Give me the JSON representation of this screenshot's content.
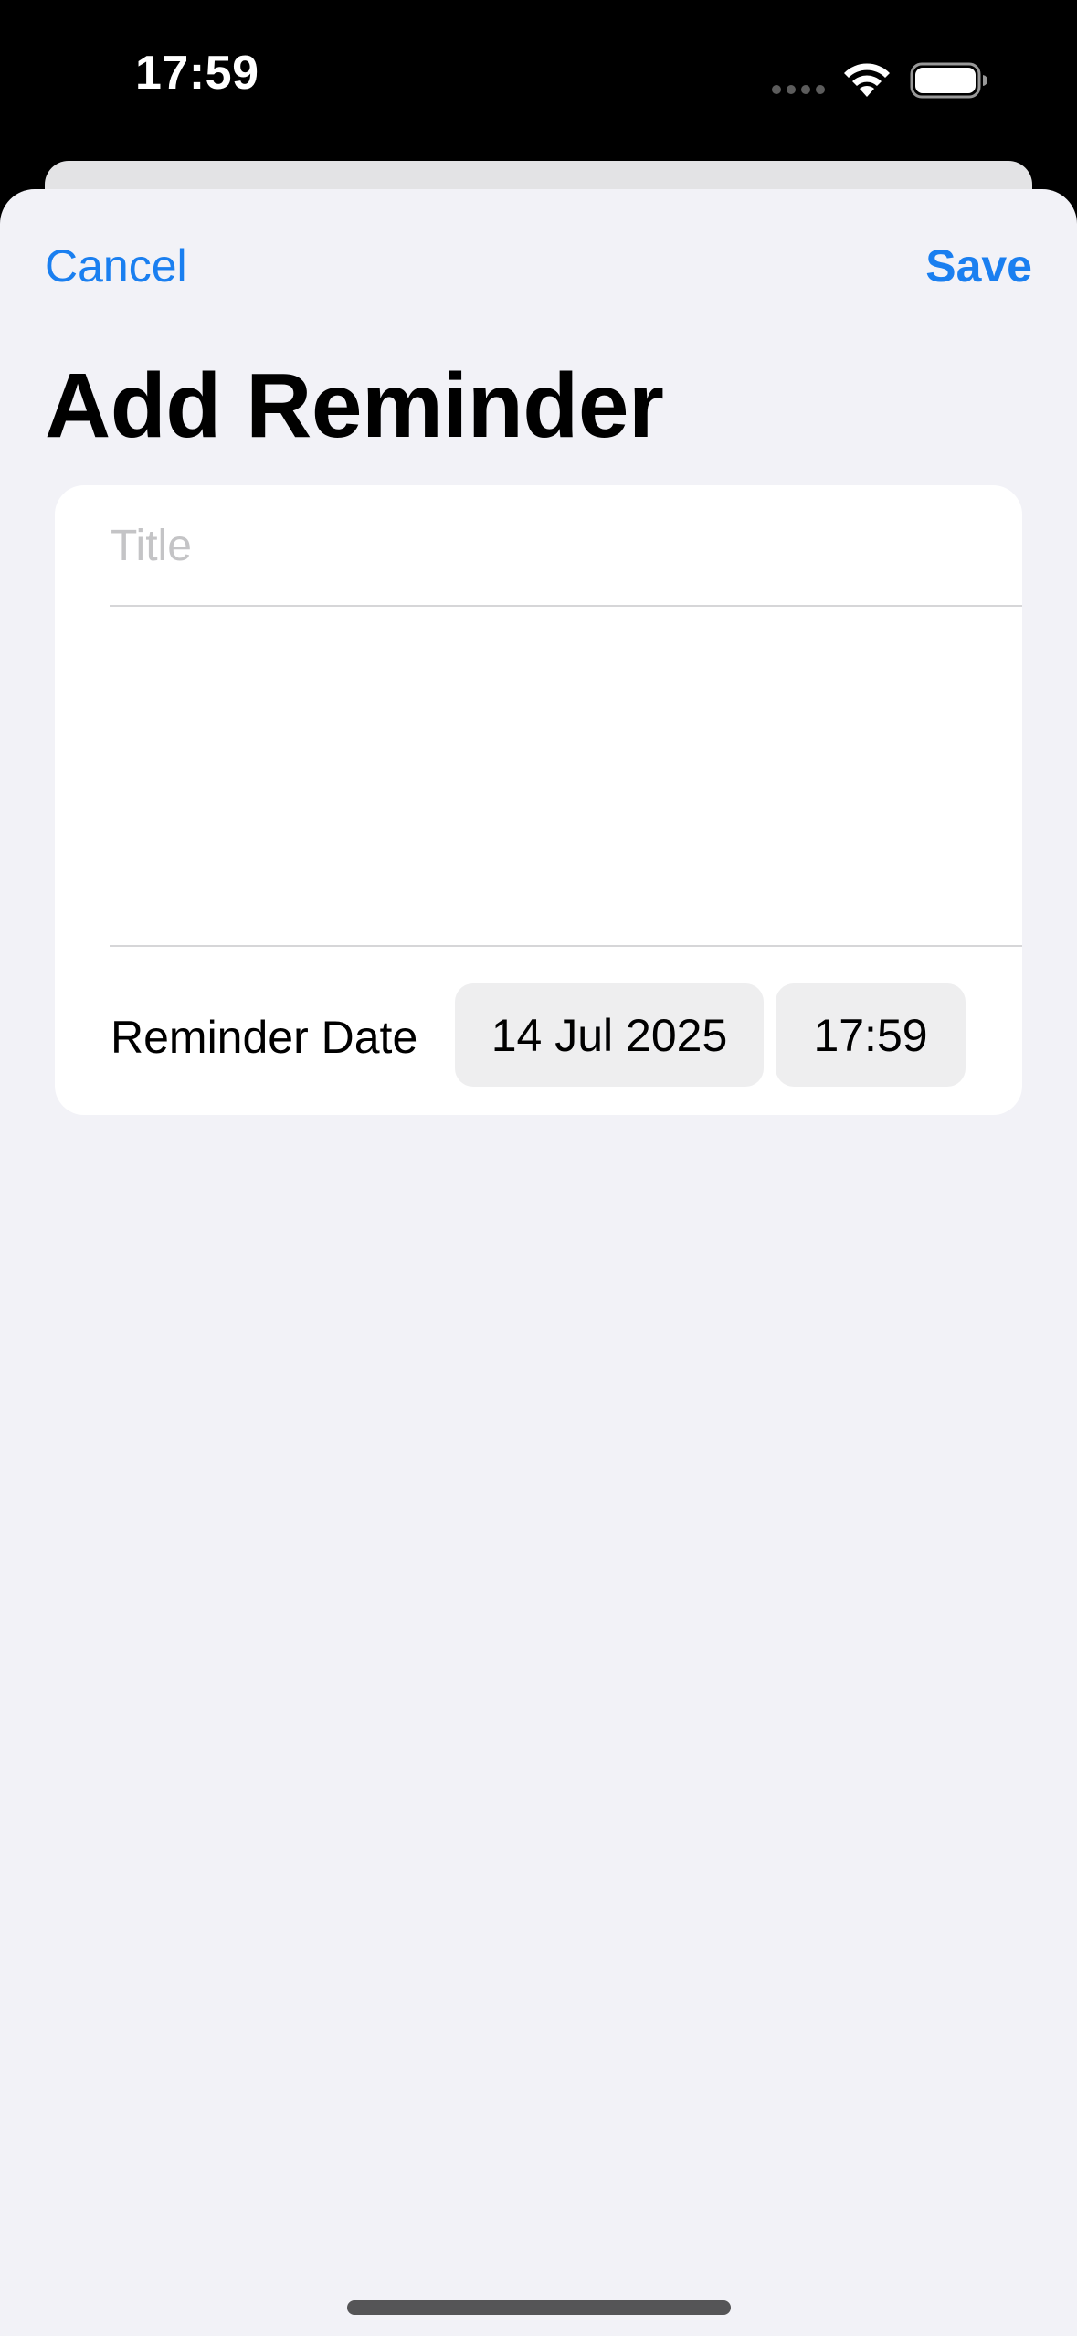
{
  "status_bar": {
    "time": "17:59",
    "icons": [
      "cellular-signal-icon",
      "wifi-icon",
      "battery-icon"
    ]
  },
  "nav": {
    "cancel_label": "Cancel",
    "save_label": "Save"
  },
  "page": {
    "title": "Add Reminder"
  },
  "form": {
    "title_field": {
      "value": "",
      "placeholder": "Title"
    },
    "notes_field": {
      "value": ""
    },
    "reminder_date": {
      "label": "Reminder Date",
      "date": "14 Jul 2025",
      "time": "17:59"
    }
  },
  "colors": {
    "accent": "#1a7ff0",
    "background": "#f2f2f7",
    "card": "#ffffff",
    "pill": "#eeeeef",
    "placeholder": "#c4c4c6"
  }
}
